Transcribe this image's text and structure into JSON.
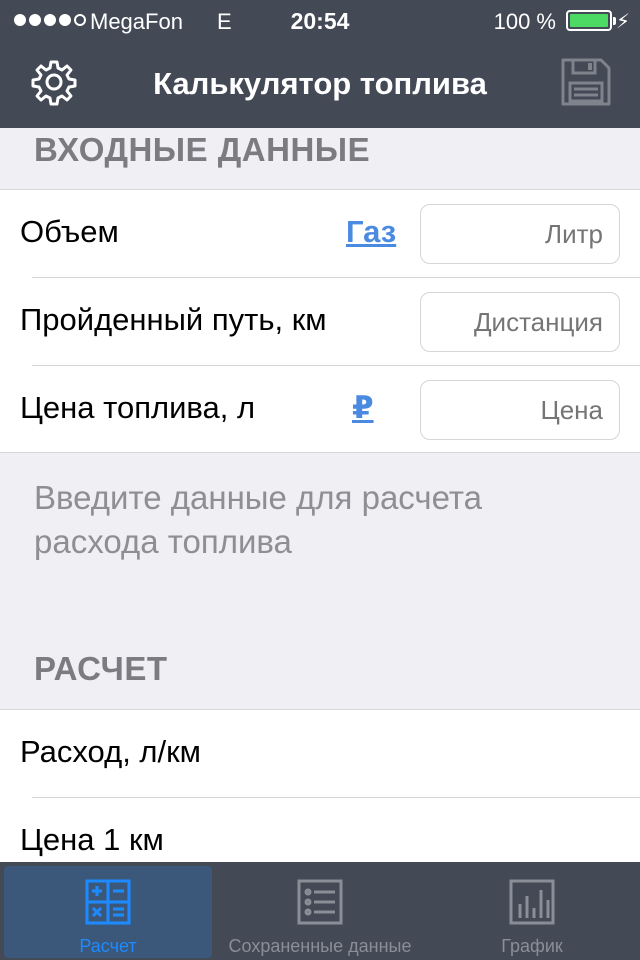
{
  "status_bar": {
    "carrier": "MegaFon",
    "network": "E",
    "time": "20:54",
    "battery_percent": "100 %",
    "signal_bars_filled": 4,
    "signal_bars_total": 5,
    "battery_color": "#4cd964"
  },
  "nav": {
    "title": "Калькулятор топлива",
    "left_icon": "gear-icon",
    "right_icon": "floppy-disk-icon"
  },
  "input_section": {
    "header": "ВХОДНЫЕ ДАННЫЕ",
    "rows": [
      {
        "label": "Объем",
        "link": "Газ",
        "placeholder": "Литр"
      },
      {
        "label": "Пройденный путь, км",
        "placeholder": "Дистанция"
      },
      {
        "label": "Цена топлива, л",
        "link": "₽",
        "placeholder": "Цена"
      }
    ],
    "hint": "Введите данные для расчета расхода топлива"
  },
  "result_section": {
    "header": "РАСЧЕТ",
    "rows": [
      {
        "label": "Расход, л/км"
      },
      {
        "label": "Цена 1 км"
      }
    ]
  },
  "tabs": [
    {
      "label": "Расчет",
      "icon": "calculator-icon",
      "active": true
    },
    {
      "label": "Сохраненные данные",
      "icon": "list-icon",
      "active": false
    },
    {
      "label": "График",
      "icon": "bar-chart-icon",
      "active": false
    }
  ],
  "colors": {
    "bar_background": "#434955",
    "accent": "#4a8ae0",
    "active_tab": "#1d8bff"
  }
}
